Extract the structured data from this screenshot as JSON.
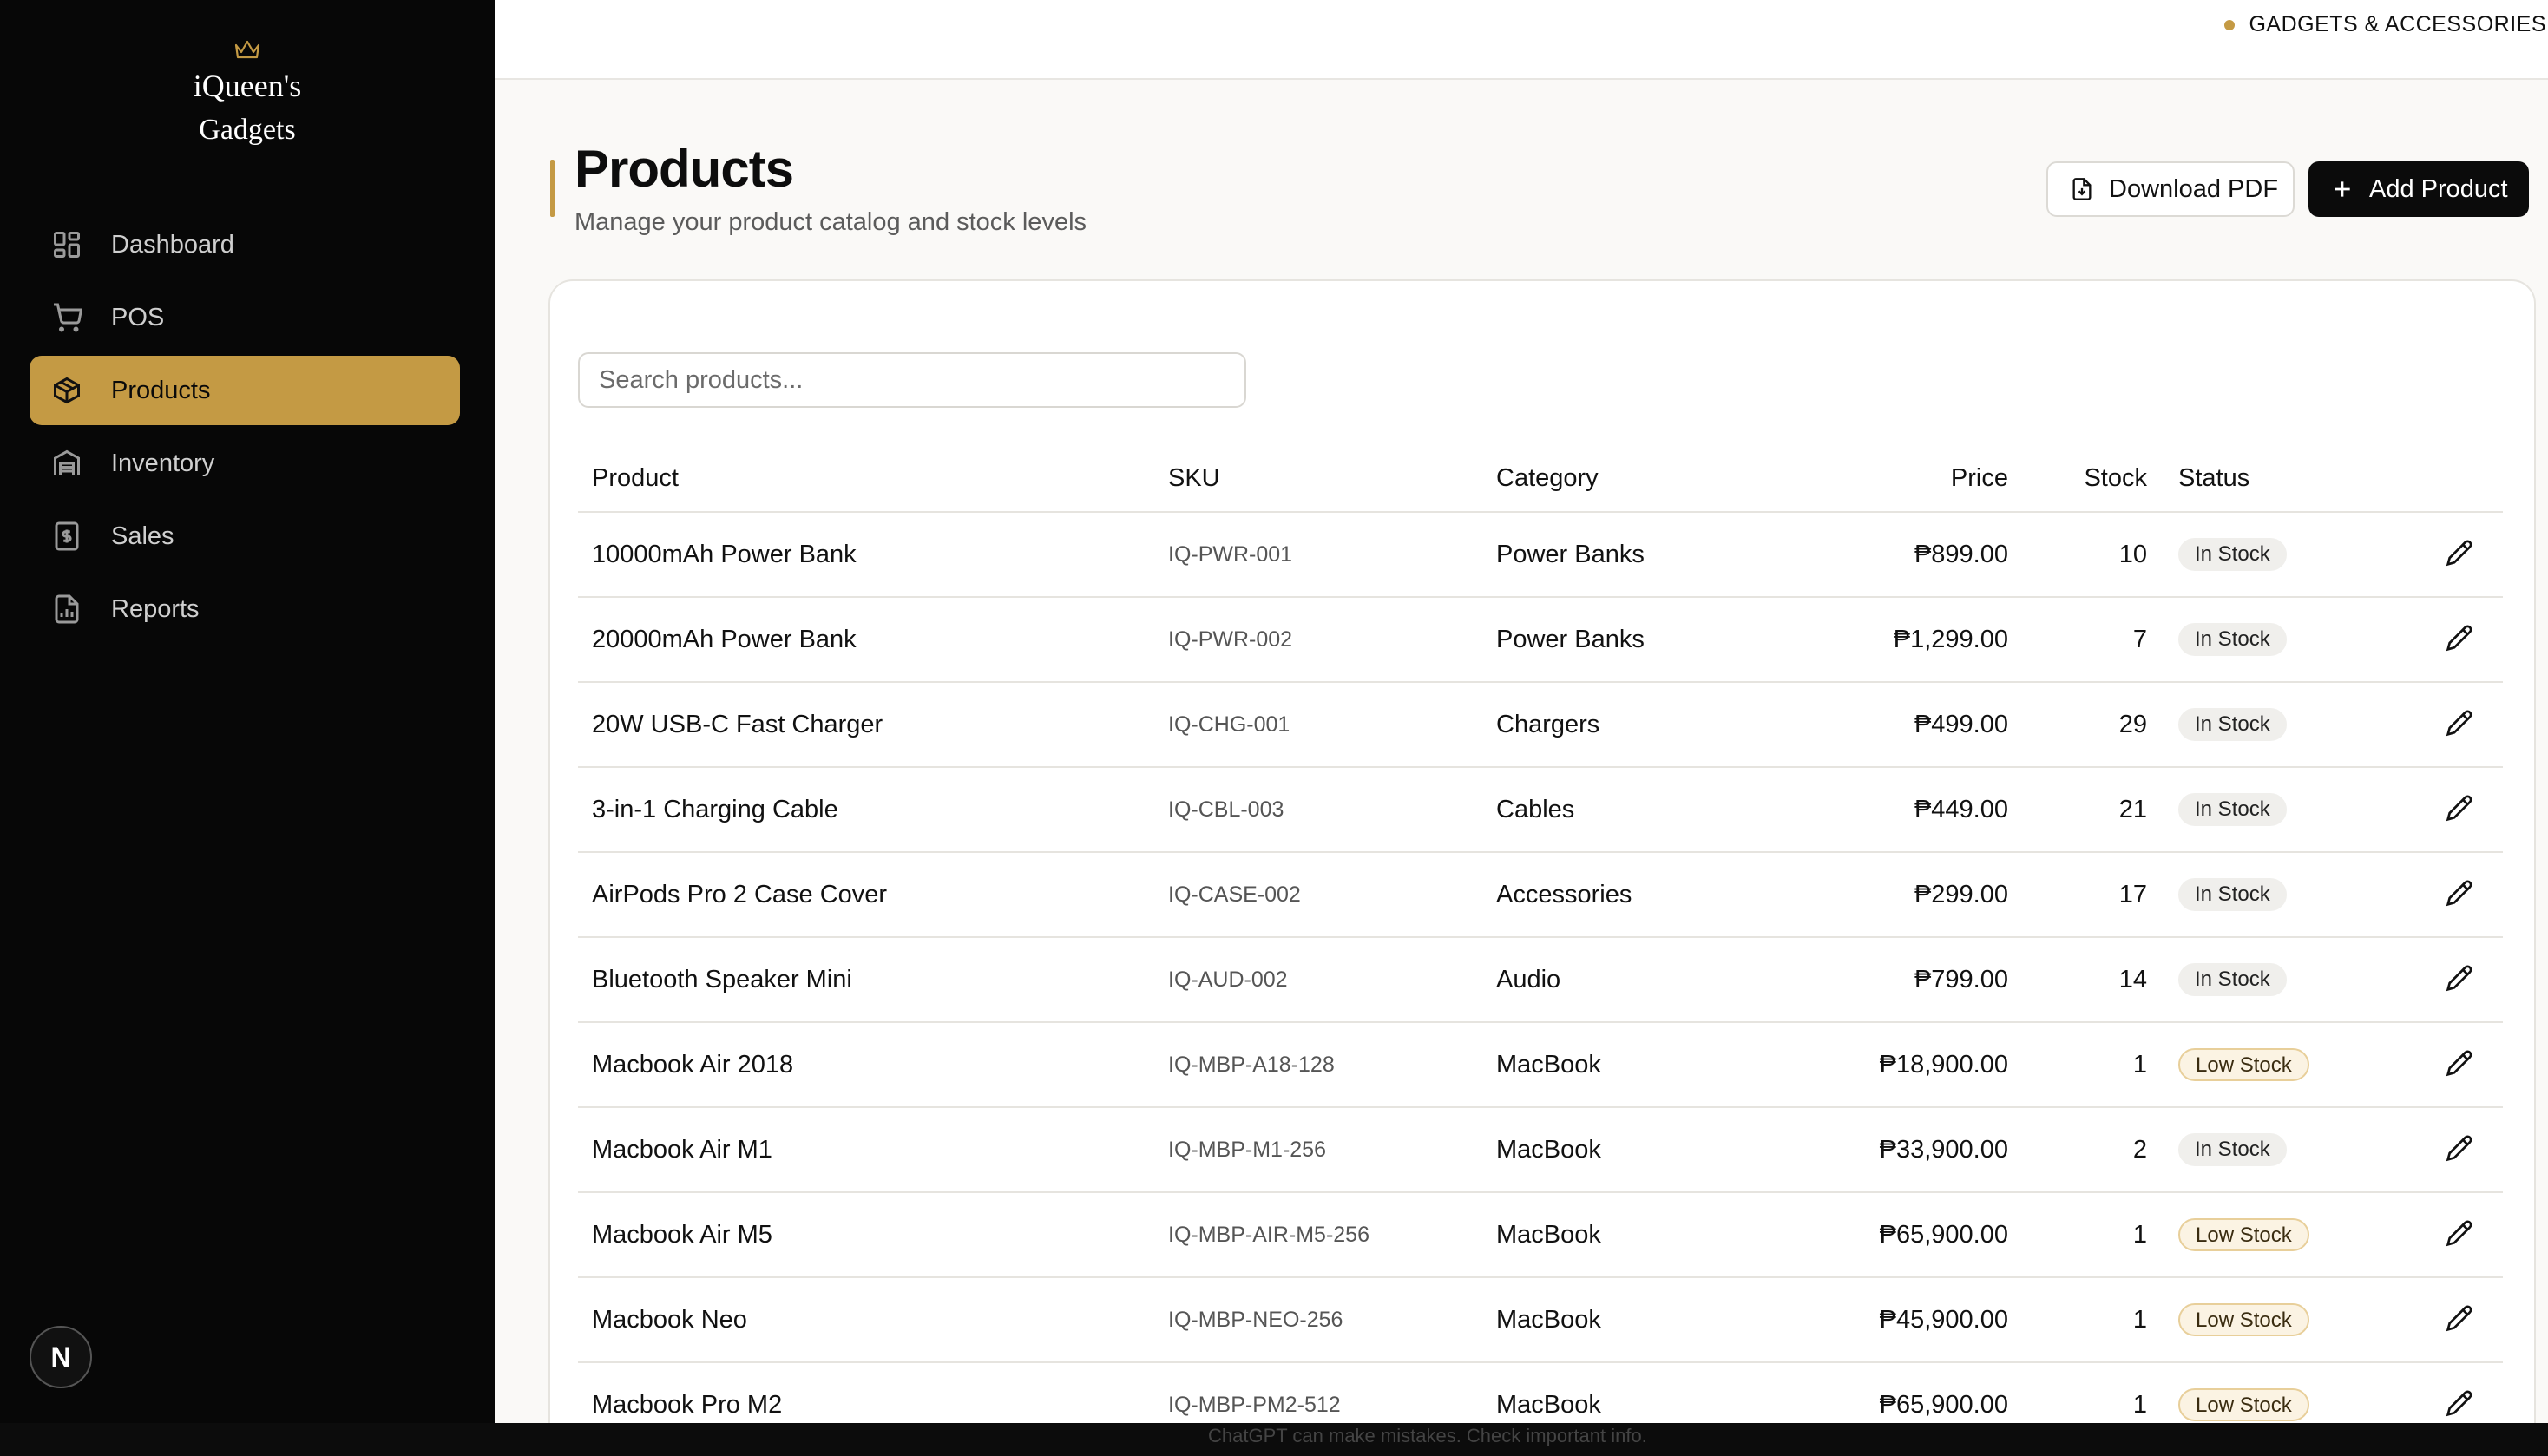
{
  "brand": {
    "name": "iQueen's",
    "sub": "Gadgets",
    "accent": "#c49a44"
  },
  "sidebar": {
    "items": [
      {
        "label": "Dashboard",
        "icon": "dashboard-grid-icon",
        "active": false
      },
      {
        "label": "POS",
        "icon": "cart-icon",
        "active": false
      },
      {
        "label": "Products",
        "icon": "box-icon",
        "active": true
      },
      {
        "label": "Inventory",
        "icon": "warehouse-icon",
        "active": false
      },
      {
        "label": "Sales",
        "icon": "dollar-receipt-icon",
        "active": false
      },
      {
        "label": "Reports",
        "icon": "report-chart-icon",
        "active": false
      }
    ],
    "avatar": "N"
  },
  "topbar": {
    "tag": "GADGETS & ACCESSORIES"
  },
  "header": {
    "title": "Products",
    "subtitle": "Manage your product catalog and stock levels",
    "download_label": "Download PDF",
    "add_label": "Add Product"
  },
  "search": {
    "placeholder": "Search products...",
    "value": ""
  },
  "table": {
    "columns": [
      "Product",
      "SKU",
      "Category",
      "Price",
      "Stock",
      "Status"
    ],
    "rows": [
      {
        "product": "10000mAh Power Bank",
        "sku": "IQ-PWR-001",
        "category": "Power Banks",
        "price": "₱899.00",
        "stock": "10",
        "status": "In Stock"
      },
      {
        "product": "20000mAh Power Bank",
        "sku": "IQ-PWR-002",
        "category": "Power Banks",
        "price": "₱1,299.00",
        "stock": "7",
        "status": "In Stock"
      },
      {
        "product": "20W USB-C Fast Charger",
        "sku": "IQ-CHG-001",
        "category": "Chargers",
        "price": "₱499.00",
        "stock": "29",
        "status": "In Stock"
      },
      {
        "product": "3-in-1 Charging Cable",
        "sku": "IQ-CBL-003",
        "category": "Cables",
        "price": "₱449.00",
        "stock": "21",
        "status": "In Stock"
      },
      {
        "product": "AirPods Pro 2 Case Cover",
        "sku": "IQ-CASE-002",
        "category": "Accessories",
        "price": "₱299.00",
        "stock": "17",
        "status": "In Stock"
      },
      {
        "product": "Bluetooth Speaker Mini",
        "sku": "IQ-AUD-002",
        "category": "Audio",
        "price": "₱799.00",
        "stock": "14",
        "status": "In Stock"
      },
      {
        "product": "Macbook Air 2018",
        "sku": "IQ-MBP-A18-128",
        "category": "MacBook",
        "price": "₱18,900.00",
        "stock": "1",
        "status": "Low Stock"
      },
      {
        "product": "Macbook Air M1",
        "sku": "IQ-MBP-M1-256",
        "category": "MacBook",
        "price": "₱33,900.00",
        "stock": "2",
        "status": "In Stock"
      },
      {
        "product": "Macbook Air M5",
        "sku": "IQ-MBP-AIR-M5-256",
        "category": "MacBook",
        "price": "₱65,900.00",
        "stock": "1",
        "status": "Low Stock"
      },
      {
        "product": "Macbook Neo",
        "sku": "IQ-MBP-NEO-256",
        "category": "MacBook",
        "price": "₱45,900.00",
        "stock": "1",
        "status": "Low Stock"
      },
      {
        "product": "Macbook Pro M2",
        "sku": "IQ-MBP-PM2-512",
        "category": "MacBook",
        "price": "₱65,900.00",
        "stock": "1",
        "status": "Low Stock"
      }
    ]
  },
  "footer_hint": "ChatGPT can make mistakes. Check important info."
}
